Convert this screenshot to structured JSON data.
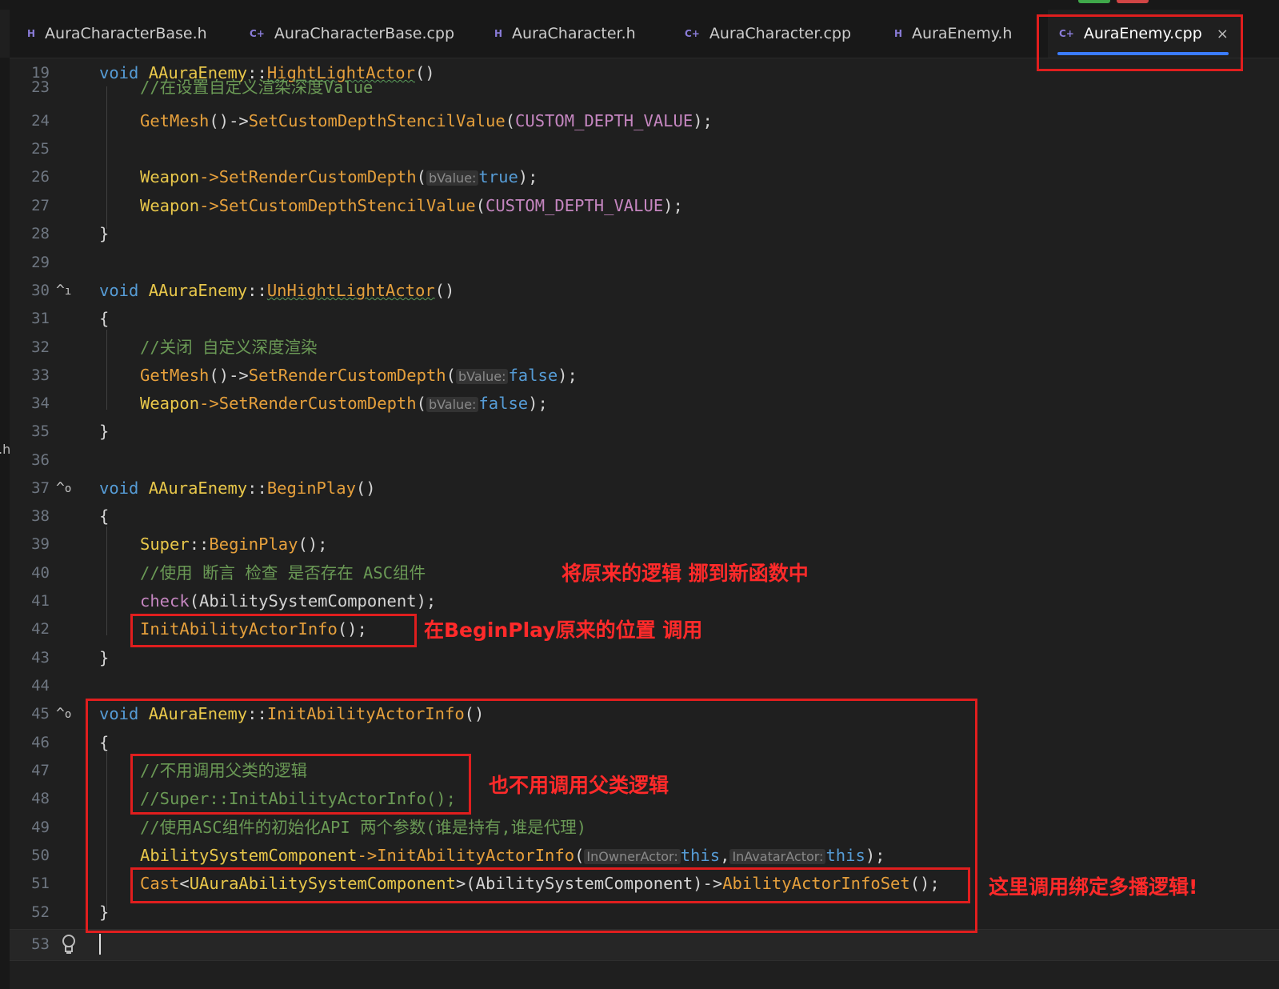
{
  "tabs": [
    {
      "type": "H",
      "label": "AuraCharacterBase.h"
    },
    {
      "type": "C+",
      "label": "AuraCharacterBase.cpp"
    },
    {
      "type": "H",
      "label": "AuraCharacter.h"
    },
    {
      "type": "C+",
      "label": "AuraCharacter.cpp"
    },
    {
      "type": "H",
      "label": "AuraEnemy.h"
    },
    {
      "type": "C+",
      "label": "AuraEnemy.cpp",
      "active": true,
      "close": "×"
    }
  ],
  "left_edge_text": ".h",
  "gutter": {
    "fold_marker": "^",
    "bookmark_marker": "ı",
    "override_marker": "o",
    "bulb_icon": "bulb-icon"
  },
  "code": {
    "l19": {
      "num": "19",
      "t1": "void",
      "t2": "AAuraEnemy",
      "t3": "::",
      "t4": "HightLightActor",
      "t5": "()"
    },
    "l23": {
      "num": "23",
      "t1": "//在设置自定义渲染深度Value"
    },
    "l24": {
      "num": "24",
      "t1": "GetMesh",
      "t2": "()->",
      "t3": "SetCustomDepthStencilValue",
      "t4": "(",
      "t5": "CUSTOM_DEPTH_VALUE",
      "t6": ");"
    },
    "l25": {
      "num": "25"
    },
    "l26": {
      "num": "26",
      "t1": "Weapon",
      "t2": "->",
      "t3": "SetRenderCustomDepth",
      "t4": "(",
      "hint": "bValue:",
      "t5": "true",
      "t6": ");"
    },
    "l27": {
      "num": "27",
      "t1": "Weapon",
      "t2": "->",
      "t3": "SetCustomDepthStencilValue",
      "t4": "(",
      "t5": "CUSTOM_DEPTH_VALUE",
      "t6": ");"
    },
    "l28": {
      "num": "28",
      "t1": "}"
    },
    "l29": {
      "num": "29"
    },
    "l30": {
      "num": "30",
      "t1": "void",
      "t2": "AAuraEnemy",
      "t3": "::",
      "t4": "UnHightLightActor",
      "t5": "()"
    },
    "l31": {
      "num": "31",
      "t1": "{"
    },
    "l32": {
      "num": "32",
      "t1": "//关闭 自定义深度渲染"
    },
    "l33": {
      "num": "33",
      "t1": "GetMesh",
      "t2": "()->",
      "t3": "SetRenderCustomDepth",
      "t4": "(",
      "hint": "bValue:",
      "t5": "false",
      "t6": ");"
    },
    "l34": {
      "num": "34",
      "t1": "Weapon",
      "t2": "->",
      "t3": "SetRenderCustomDepth",
      "t4": "(",
      "hint": "bValue:",
      "t5": "false",
      "t6": ");"
    },
    "l35": {
      "num": "35",
      "t1": "}"
    },
    "l36": {
      "num": "36"
    },
    "l37": {
      "num": "37",
      "t1": "void",
      "t2": "AAuraEnemy",
      "t3": "::",
      "t4": "BeginPlay",
      "t5": "()"
    },
    "l38": {
      "num": "38",
      "t1": "{"
    },
    "l39": {
      "num": "39",
      "t1": "Super",
      "t2": "::",
      "t3": "BeginPlay",
      "t4": "();"
    },
    "l40": {
      "num": "40",
      "t1": "//使用 断言 检查 是否存在 ASC组件"
    },
    "l41": {
      "num": "41",
      "t1": "check",
      "t2": "(AbilitySystemComponent);"
    },
    "l42": {
      "num": "42",
      "t1": "InitAbilityActorInfo",
      "t2": "();"
    },
    "l43": {
      "num": "43",
      "t1": "}"
    },
    "l44": {
      "num": "44"
    },
    "l45": {
      "num": "45",
      "t1": "void",
      "t2": "AAuraEnemy",
      "t3": "::",
      "t4": "InitAbilityActorInfo",
      "t5": "()"
    },
    "l46": {
      "num": "46",
      "t1": "{"
    },
    "l47": {
      "num": "47",
      "t1": "//不用调用父类的逻辑"
    },
    "l48": {
      "num": "48",
      "t1": "//Super::InitAbilityActorInfo();"
    },
    "l49": {
      "num": "49",
      "t1": "//使用ASC组件的初始化API 两个参数(谁是持有,谁是代理)"
    },
    "l50": {
      "num": "50",
      "t1": "AbilitySystemComponent",
      "t2": "->",
      "t3": "InitAbilityActorInfo",
      "t4": "(",
      "hint1": "InOwnerActor:",
      "t5": "this",
      "t6": ",",
      "hint2": "InAvatarActor:",
      "t7": "this",
      "t8": ");"
    },
    "l51": {
      "num": "51",
      "t1": "Cast",
      "t2": "<",
      "t3": "UAuraAbilitySystemComponent",
      "t4": ">(AbilitySystemComponent)->",
      "t5": "AbilityActorInfoSet",
      "t6": "();"
    },
    "l52": {
      "num": "52",
      "t1": "}"
    },
    "l53": {
      "num": "53"
    }
  },
  "annotations": {
    "a1": "将原来的逻辑 挪到新函数中",
    "a2": "在BeginPlay原来的位置 调用",
    "a3": "也不用调用父类逻辑",
    "a4": "这里调用绑定多播逻辑!"
  },
  "colors": {
    "background": "#1f1f1f",
    "keyword": "#569cd6",
    "class": "#e8c74a",
    "function": "#e6a03c",
    "macro": "#c586c0",
    "comment": "#6a9955",
    "annotation_red": "#e01e1e",
    "active_tab_underline": "#3b7cff"
  }
}
